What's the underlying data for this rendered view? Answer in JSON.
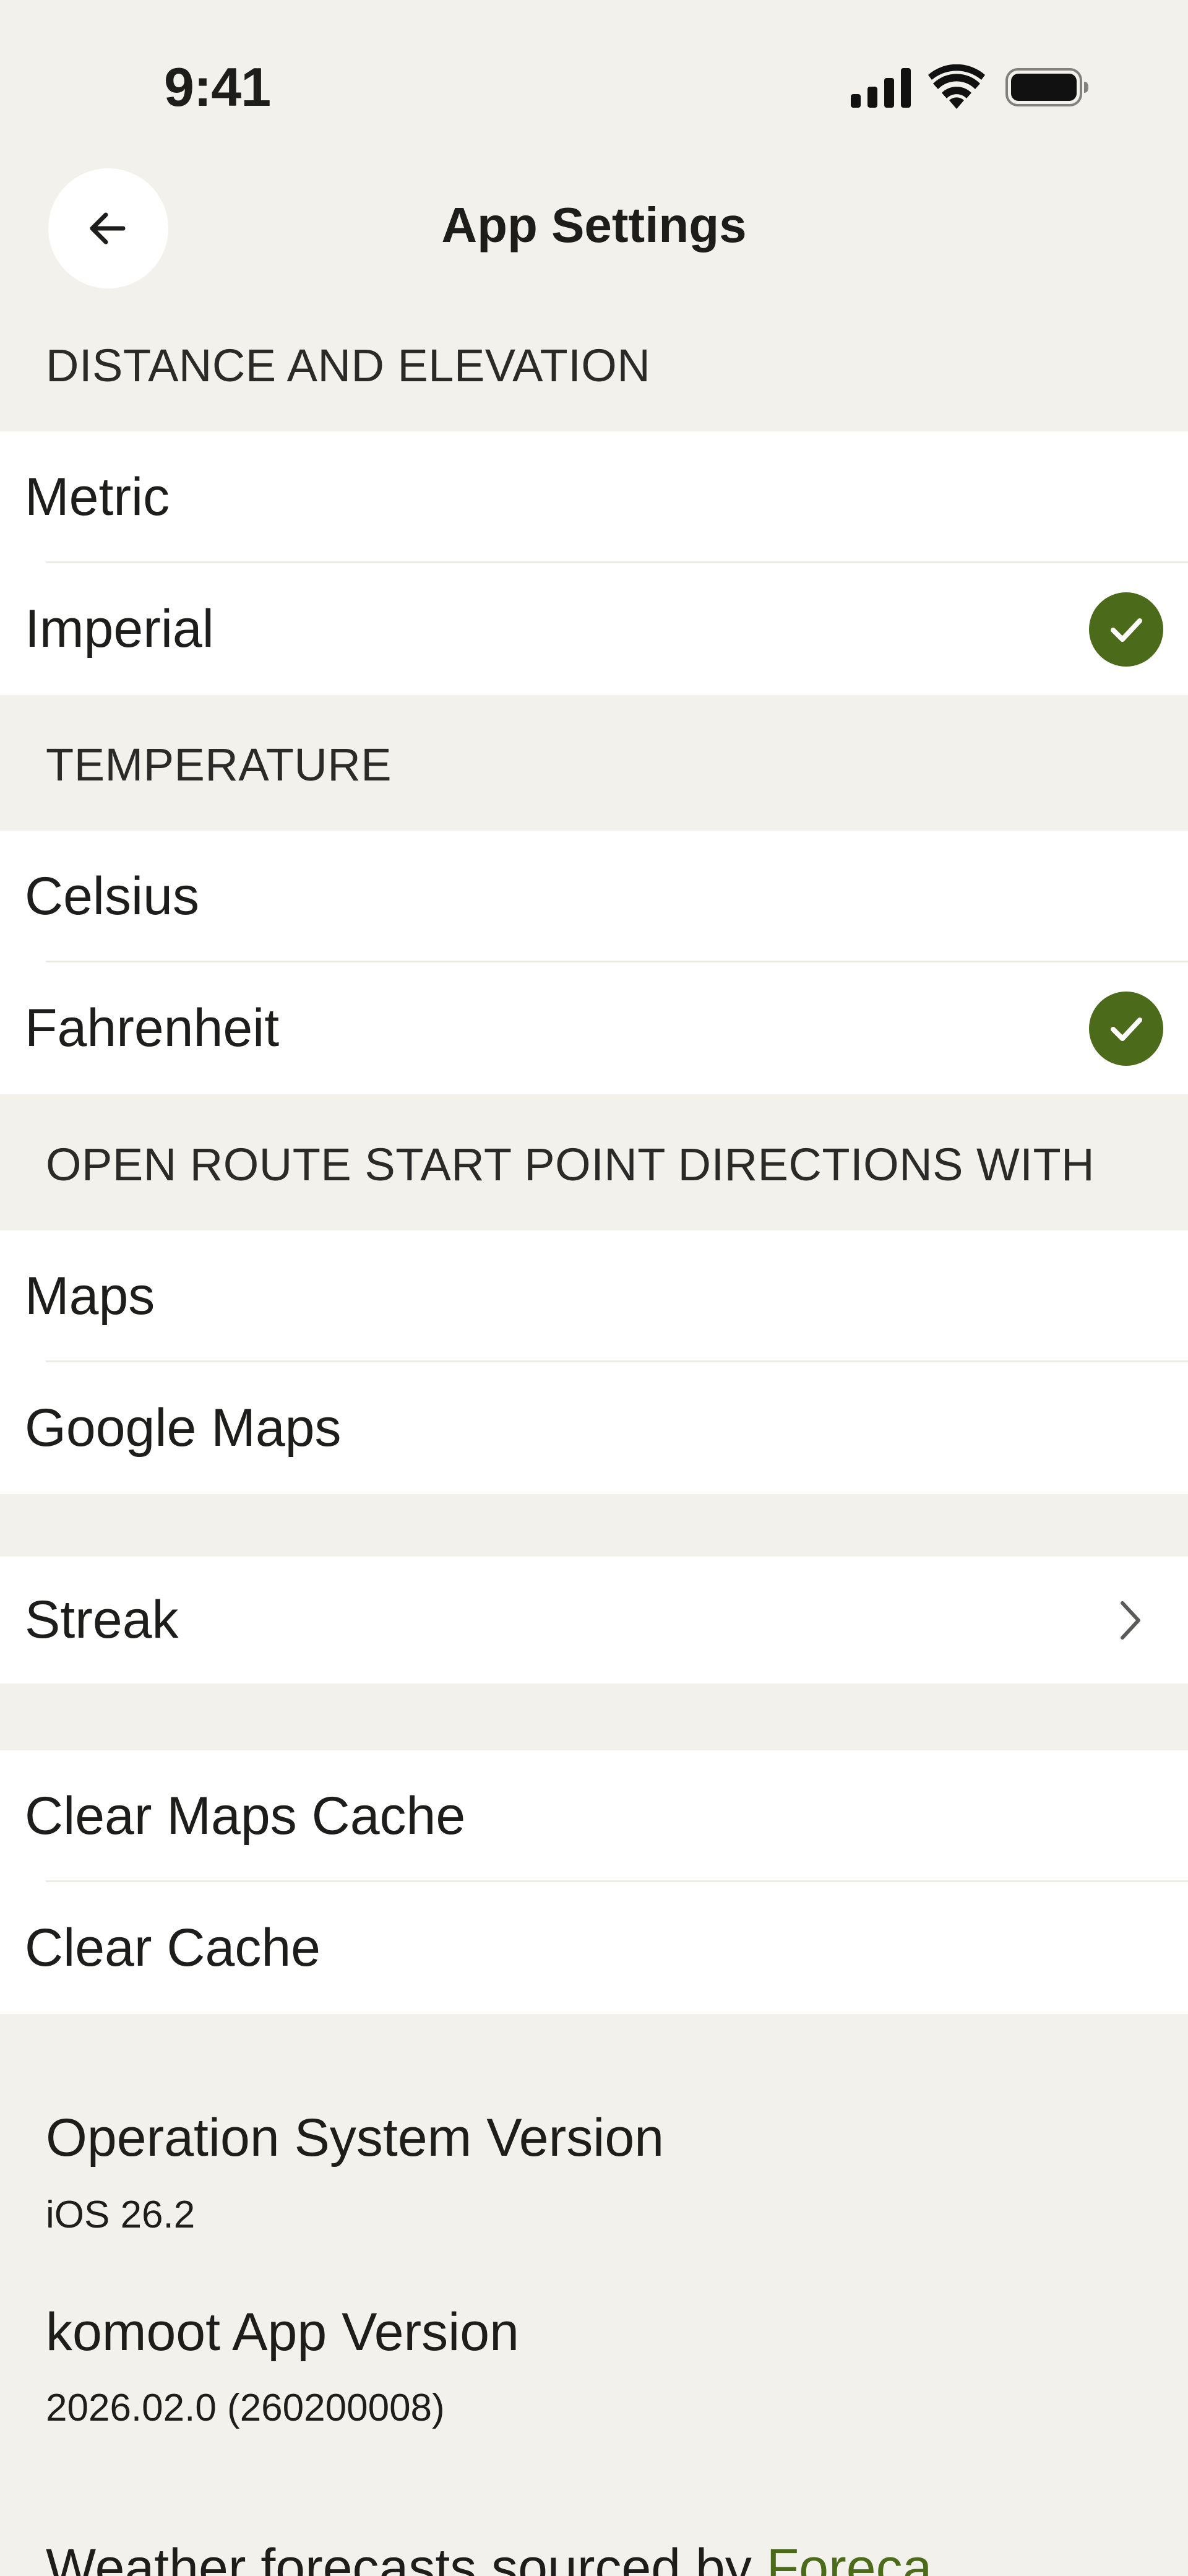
{
  "status_bar": {
    "time": "9:41",
    "icons": [
      "signal-icon",
      "wifi-icon",
      "battery-icon"
    ]
  },
  "header": {
    "back_icon": "arrow-left-icon",
    "title": "App Settings"
  },
  "sections": {
    "distance": {
      "header": "DISTANCE AND ELEVATION",
      "options": [
        {
          "label": "Metric",
          "selected": false
        },
        {
          "label": "Imperial",
          "selected": true
        }
      ]
    },
    "temperature": {
      "header": "TEMPERATURE",
      "options": [
        {
          "label": "Celsius",
          "selected": false
        },
        {
          "label": "Fahrenheit",
          "selected": true
        }
      ]
    },
    "directions": {
      "header": "OPEN ROUTE START POINT DIRECTIONS WITH",
      "options": [
        {
          "label": "Maps",
          "selected": false
        },
        {
          "label": "Google Maps",
          "selected": false
        }
      ]
    },
    "streak": {
      "label": "Streak",
      "icon": "chevron-right-icon"
    },
    "cache": {
      "items": [
        {
          "label": "Clear Maps Cache"
        },
        {
          "label": "Clear Cache"
        }
      ]
    }
  },
  "info": {
    "os_version_title": "Operation System Version",
    "os_version_value": "iOS 26.2",
    "app_version_title": "komoot App Version",
    "app_version_value": "2026.02.0 (260200008)"
  },
  "footer": {
    "text": "Weather forecasts sourced by ",
    "link": "Foreca"
  },
  "colors": {
    "background": "#f3f1ec",
    "surface": "#ffffff",
    "accent": "#4b6b1b",
    "text": "#1d1d1b"
  }
}
